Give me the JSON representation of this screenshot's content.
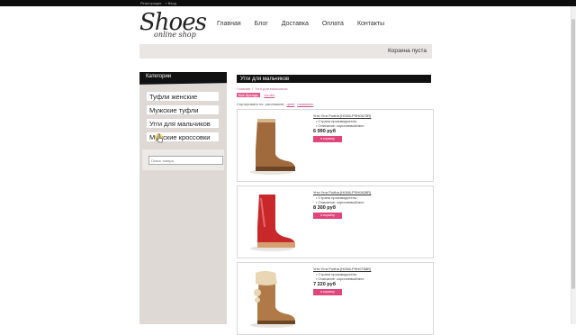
{
  "topbar": {
    "register": "Регистрация",
    "login": "» Вход"
  },
  "logo": {
    "main": "Shoes",
    "sub": "online shop"
  },
  "nav": [
    "Главная",
    "Блог",
    "Доставка",
    "Оплата",
    "Контакты"
  ],
  "cart": {
    "text": "Корзина пуста"
  },
  "sidebar": {
    "title": "Категории",
    "items": [
      "Туфли женские",
      "Мужские туфли",
      "Угги для мальчиков",
      "Мужские кроссовки"
    ],
    "search_placeholder": "Поиск товара"
  },
  "content": {
    "title": "Угги для мальчиков",
    "breadcrumbs": [
      "Главная",
      "Угги для мальчиков"
    ],
    "brand_active": "Все бренды",
    "brand_link": "Jumbo",
    "sort_label": "Сортировать по: умолчанию",
    "sort_options": [
      "цене",
      "названию"
    ]
  },
  "products": [
    {
      "title": "Угги Угги Pudha (HG66-PSH0573R)",
      "country_label": "Страна производитель:",
      "desc_label": "Описание:",
      "desc": "коричневый/мех",
      "price": "6 990 руб",
      "button": "в корзину",
      "color": "#a06a3c"
    },
    {
      "title": "Угги Угги Pudha (HG66-PSH0628R)",
      "country_label": "Страна производитель:",
      "desc_label": "Описание:",
      "desc": "коричневый/мех",
      "price": "8 300 руб",
      "button": "в корзину",
      "color": "#c8282a"
    },
    {
      "title": "Угги Угги Pudha (HG66-PSH0758R)",
      "country_label": "Страна производитель:",
      "desc_label": "Описание:",
      "desc": "коричневый/мех",
      "price": "7 220 руб",
      "button": "в корзину",
      "color": "#b07a48"
    }
  ]
}
